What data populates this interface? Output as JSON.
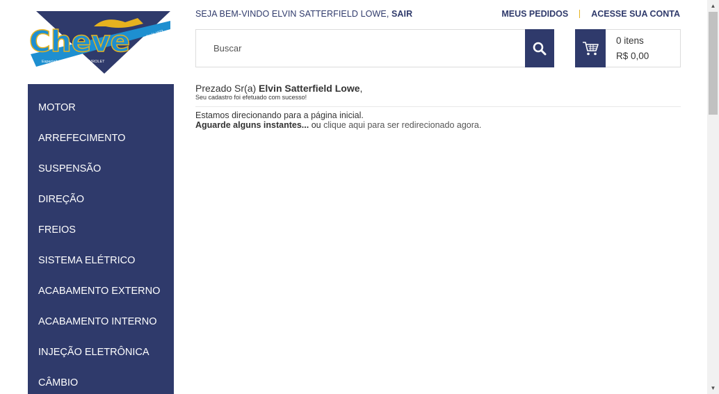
{
  "brand": {
    "name": "Cheve",
    "tagline": "Especialista em Peças CHEVROLET",
    "badge": "desde 1973"
  },
  "header": {
    "welcome_prefix": "SEJA BEM-VINDO ELVIN SATTERFIELD LOWE,",
    "logout": "SAIR",
    "orders": "MEUS PEDIDOS",
    "account": "ACESSE SUA CONTA"
  },
  "search": {
    "placeholder": "Buscar"
  },
  "cart": {
    "count": "0 itens",
    "total": "R$ 0,00"
  },
  "sidebar": {
    "items": [
      {
        "label": "MOTOR"
      },
      {
        "label": "ARREFECIMENTO"
      },
      {
        "label": "SUSPENSÃO"
      },
      {
        "label": "DIREÇÃO"
      },
      {
        "label": "FREIOS"
      },
      {
        "label": "SISTEMA ELÉTRICO"
      },
      {
        "label": "ACABAMENTO EXTERNO"
      },
      {
        "label": "ACABAMENTO INTERNO"
      },
      {
        "label": "INJEÇÃO ELETRÔNICA"
      },
      {
        "label": "CÂMBIO"
      }
    ]
  },
  "content": {
    "greeting_prefix": "Prezado Sr(a)",
    "greeting_name": "Elvin Satterfield Lowe",
    "greeting_suffix": ",",
    "success": "Seu cadastro foi efetuado com sucesso!",
    "redirect": "Estamos direcionando para a página inicial.",
    "wait": "Aguarde alguns instantes...",
    "or_text": " ou ",
    "click_here": "clique aqui para ser redirecionado agora."
  },
  "colors": {
    "primary": "#2f3a6b",
    "accent": "#e6b21f"
  }
}
